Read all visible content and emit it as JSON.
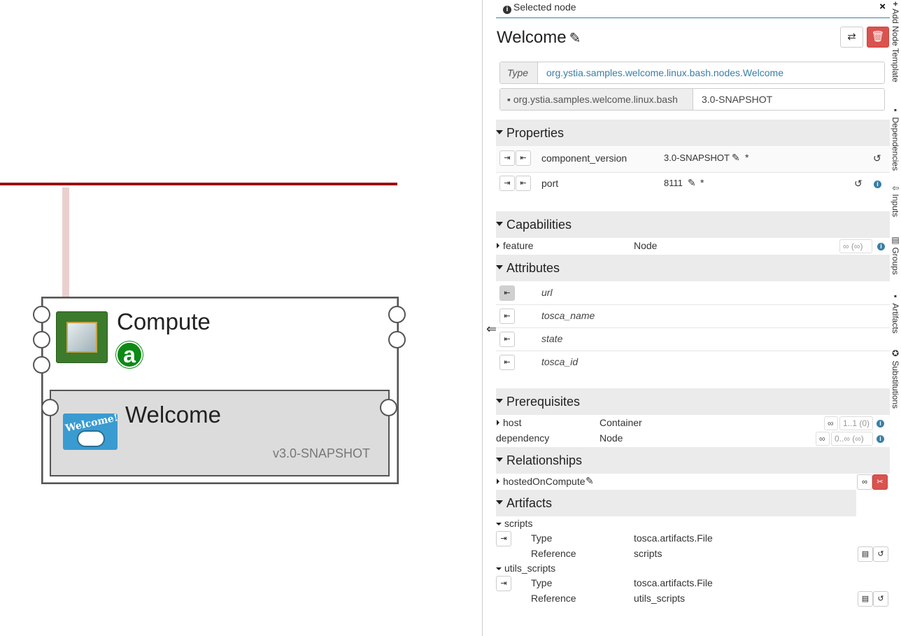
{
  "canvas": {
    "compute": {
      "title": "Compute",
      "badge": "a"
    },
    "welcome": {
      "title": "Welcome",
      "version": "v3.0-SNAPSHOT",
      "icon_text": "Welcome!"
    }
  },
  "panel": {
    "header": {
      "title": "Selected node",
      "close": "×"
    },
    "node_name": "Welcome",
    "type_label": "Type",
    "type_value": "org.ystia.samples.welcome.linux.bash.nodes.Welcome",
    "archive_name": "org.ystia.samples.welcome.linux.bash",
    "archive_version": "3.0-SNAPSHOT",
    "properties": {
      "title": "Properties",
      "items": [
        {
          "name": "component_version",
          "value": "3.0-SNAPSHOT",
          "star": "*"
        },
        {
          "name": "port",
          "value": "8111",
          "star": "*"
        }
      ]
    },
    "capabilities": {
      "title": "Capabilities",
      "items": [
        {
          "name": "feature",
          "type": "Node",
          "bounds": "∞ (∞)"
        }
      ]
    },
    "attributes": {
      "title": "Attributes",
      "items": [
        "url",
        "tosca_name",
        "state",
        "tosca_id"
      ]
    },
    "prerequisites": {
      "title": "Prerequisites",
      "items": [
        {
          "name": "host",
          "type": "Container",
          "bounds": "1..1 (0)"
        },
        {
          "name": "dependency",
          "type": "Node",
          "bounds": "0..∞ (∞)"
        }
      ]
    },
    "relationships": {
      "title": "Relationships",
      "items": [
        {
          "name": "hostedOnCompute"
        }
      ]
    },
    "artifacts": {
      "title": "Artifacts",
      "type_label": "Type",
      "reference_label": "Reference",
      "items": [
        {
          "name": "scripts",
          "type": "tosca.artifacts.File",
          "reference": "scripts"
        },
        {
          "name": "utils_scripts",
          "type": "tosca.artifacts.File",
          "reference": "utils_scripts"
        }
      ]
    }
  },
  "rail": {
    "items": [
      {
        "label": "Add Node Template",
        "icon": "plus-icon",
        "glyph": "+"
      },
      {
        "label": "Dependencies",
        "icon": "archive-icon",
        "glyph": "▪"
      },
      {
        "label": "Inputs",
        "icon": "download-icon",
        "glyph": "⇩"
      },
      {
        "label": "Groups",
        "icon": "list-icon",
        "glyph": "▤"
      },
      {
        "label": "Artifacts",
        "icon": "file-icon",
        "glyph": "▪"
      },
      {
        "label": "Substitutions",
        "icon": "cog-icon",
        "glyph": "✪"
      }
    ]
  },
  "colors": {
    "network": "#9b0f12",
    "accent": "#3a7ea6",
    "danger": "#d9534f",
    "badge": "#0d8a16"
  }
}
